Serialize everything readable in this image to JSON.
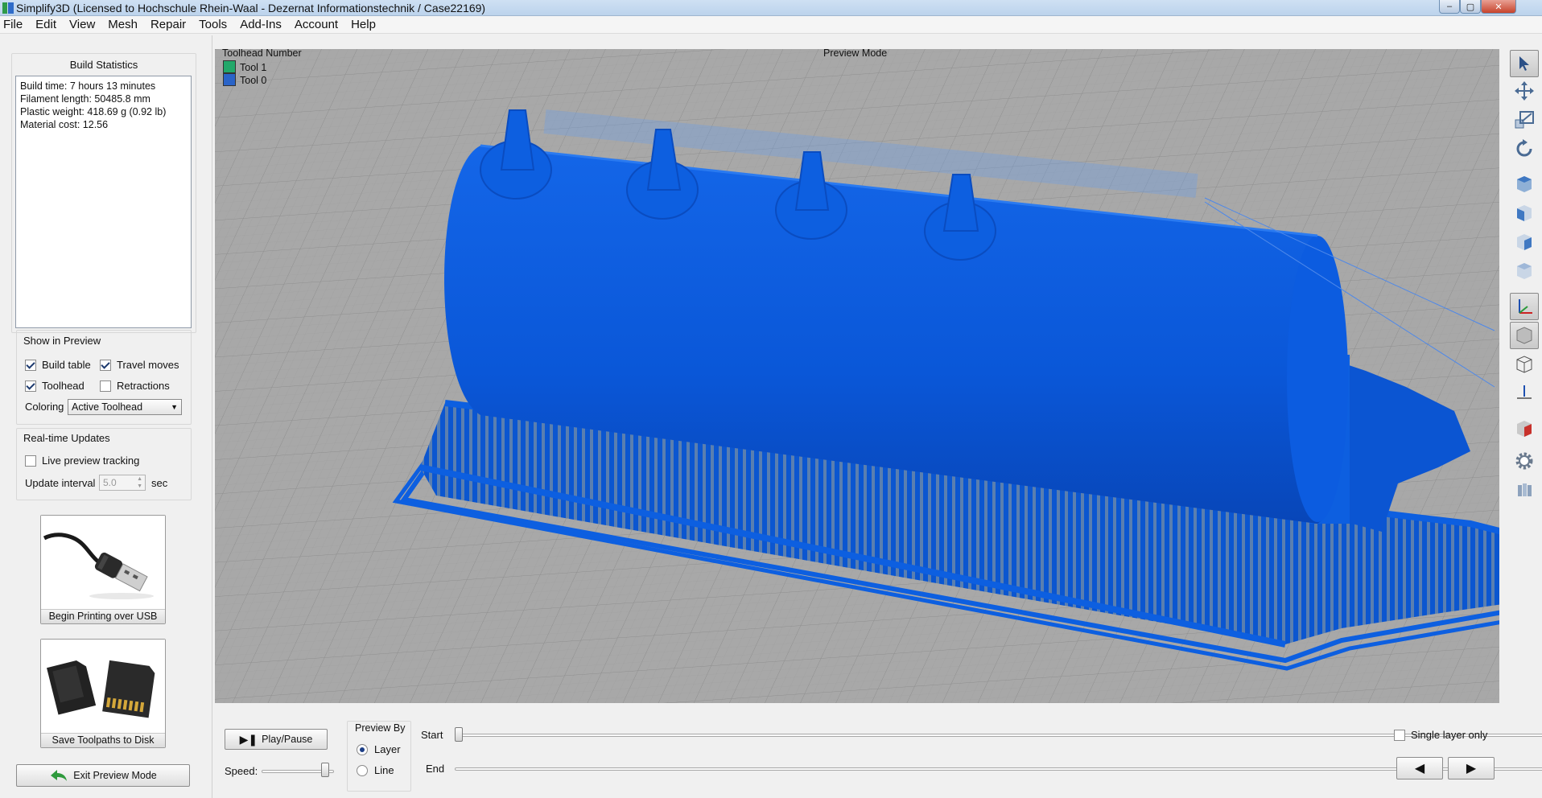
{
  "window": {
    "title": "Simplify3D (Licensed to Hochschule Rhein-Waal - Dezernat Informationstechnik / Case22169)",
    "minimize": "–",
    "maximize": "▢",
    "close": "✕"
  },
  "menu": [
    "File",
    "Edit",
    "View",
    "Mesh",
    "Repair",
    "Tools",
    "Add-Ins",
    "Account",
    "Help"
  ],
  "build_statistics": {
    "title": "Build Statistics",
    "lines": [
      "Build time: 7 hours 13 minutes",
      "Filament length: 50485.8 mm",
      "Plastic weight: 418.69 g (0.92 lb)",
      "Material cost: 12.56"
    ]
  },
  "show_in_preview": {
    "title": "Show in Preview",
    "build_table": {
      "label": "Build table",
      "checked": true
    },
    "travel_moves": {
      "label": "Travel moves",
      "checked": true
    },
    "toolhead": {
      "label": "Toolhead",
      "checked": true
    },
    "retractions": {
      "label": "Retractions",
      "checked": false
    },
    "coloring_label": "Coloring",
    "coloring_value": "Active Toolhead"
  },
  "realtime_updates": {
    "title": "Real-time Updates",
    "live_preview": {
      "label": "Live preview tracking",
      "checked": false
    },
    "update_interval_label": "Update interval",
    "update_interval_value": "5.0",
    "update_interval_unit": "sec"
  },
  "actions": {
    "usb_label": "Begin Printing over USB",
    "sd_label": "Save Toolpaths to Disk",
    "exit_label": "Exit Preview Mode"
  },
  "viewport": {
    "legend_title": "Toolhead Number",
    "mode_label": "Preview Mode",
    "tools": [
      {
        "label": "Tool 1",
        "color": "#22a86a"
      },
      {
        "label": "Tool 0",
        "color": "#2a64c8"
      }
    ],
    "model_color": "#0d5fe0",
    "grid_color": "#8e8e8e"
  },
  "playback": {
    "play_pause_label": "Play/Pause",
    "speed_label": "Speed:",
    "speed_fraction": 0.93,
    "preview_by_title": "Preview By",
    "layer_label": "Layer",
    "line_label": "Line",
    "selected": "layer",
    "start_label": "Start",
    "end_label": "End",
    "start_fraction": 0.0,
    "end_fraction": 1.0,
    "single_layer_label": "Single layer only",
    "single_layer_checked": false,
    "prev_icon": "◀",
    "next_icon": "▶"
  },
  "toolbar_icons": [
    "select-arrow-icon",
    "move-icon",
    "scale-icon",
    "rotate-icon",
    "view-top-cube-icon",
    "view-front-cube-icon",
    "view-side-cube-icon",
    "view-iso-cube-icon",
    "axes-icon",
    "solid-cube-icon",
    "wireframe-cube-icon",
    "build-plate-icon",
    "section-cube-icon",
    "settings-gear-icon",
    "layers-icon"
  ]
}
